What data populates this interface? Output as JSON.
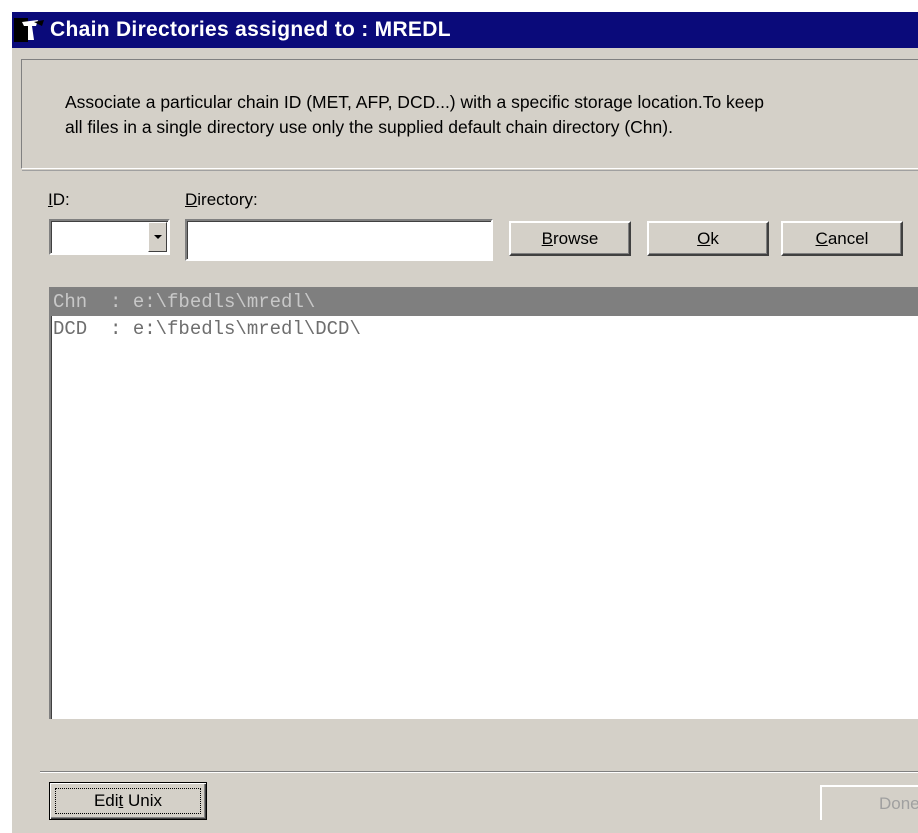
{
  "window": {
    "title": "Chain Directories assigned to : MREDL"
  },
  "description": "Associate a particular chain ID (MET, AFP, DCD...) with a specific storage location.To keep\nall files in a single directory use only the supplied default chain directory (Chn).",
  "form": {
    "id_label_accel": "I",
    "id_label_rest": "D:",
    "directory_label_accel": "D",
    "directory_label_rest": "irectory:",
    "id_value": "",
    "directory_value": ""
  },
  "buttons": {
    "browse_accel": "B",
    "browse_rest": "rowse",
    "ok_accel": "O",
    "ok_rest": "k",
    "cancel_accel": "C",
    "cancel_rest": "ancel",
    "edit_unix_pre": "Edi",
    "edit_unix_accel": "t",
    "edit_unix_post": " Unix",
    "done": "Done"
  },
  "list": {
    "items": [
      {
        "text": "Chn  : e:\\fbedls\\mredl\\",
        "selected": true
      },
      {
        "text": "DCD  : e:\\fbedls\\mredl\\DCD\\",
        "selected": false
      }
    ]
  },
  "colors": {
    "titlebar": "#0a0a7a",
    "dialog": "#d4d0c8",
    "selection": "#7f7f7f"
  }
}
